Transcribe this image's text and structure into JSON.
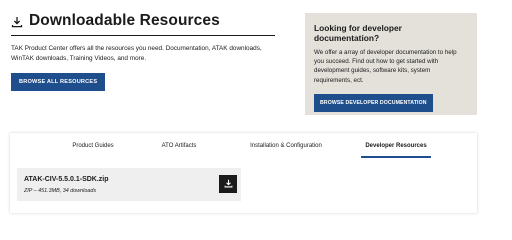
{
  "header": {
    "title": "Downloadable Resources",
    "intro": "TAK Product Center offers all the resources you need. Documentation, ATAK downloads, WinTAK downloads, Training Videos, and more.",
    "browse_all_label": "BROWSE ALL RESOURCES",
    "title_icon": "download-icon"
  },
  "callout": {
    "heading": "Looking for developer documentation?",
    "body": "We offer a array of developer documentation to help you succeed. Find out how to get started with development guides, software kits, system requirements, ect.",
    "button_label": "BROWSE DEVELOPER DOCUMENTATION"
  },
  "tabs": [
    {
      "label": "Product Guides",
      "active": false
    },
    {
      "label": "ATO Artifacts",
      "active": false
    },
    {
      "label": "Installation & Configuration",
      "active": false
    },
    {
      "label": "Developer Resources",
      "active": true
    }
  ],
  "files": [
    {
      "name": "ATAK-CIV-5.5.0.1-SDK.zip",
      "meta": "ZIP – 451.3MB, 34 downloads",
      "icon": "download-icon"
    }
  ],
  "colors": {
    "primary": "#1f4e8c",
    "callout_bg": "#e3e1da",
    "file_bg": "#efefef",
    "download_button": "#1b1b1b"
  }
}
